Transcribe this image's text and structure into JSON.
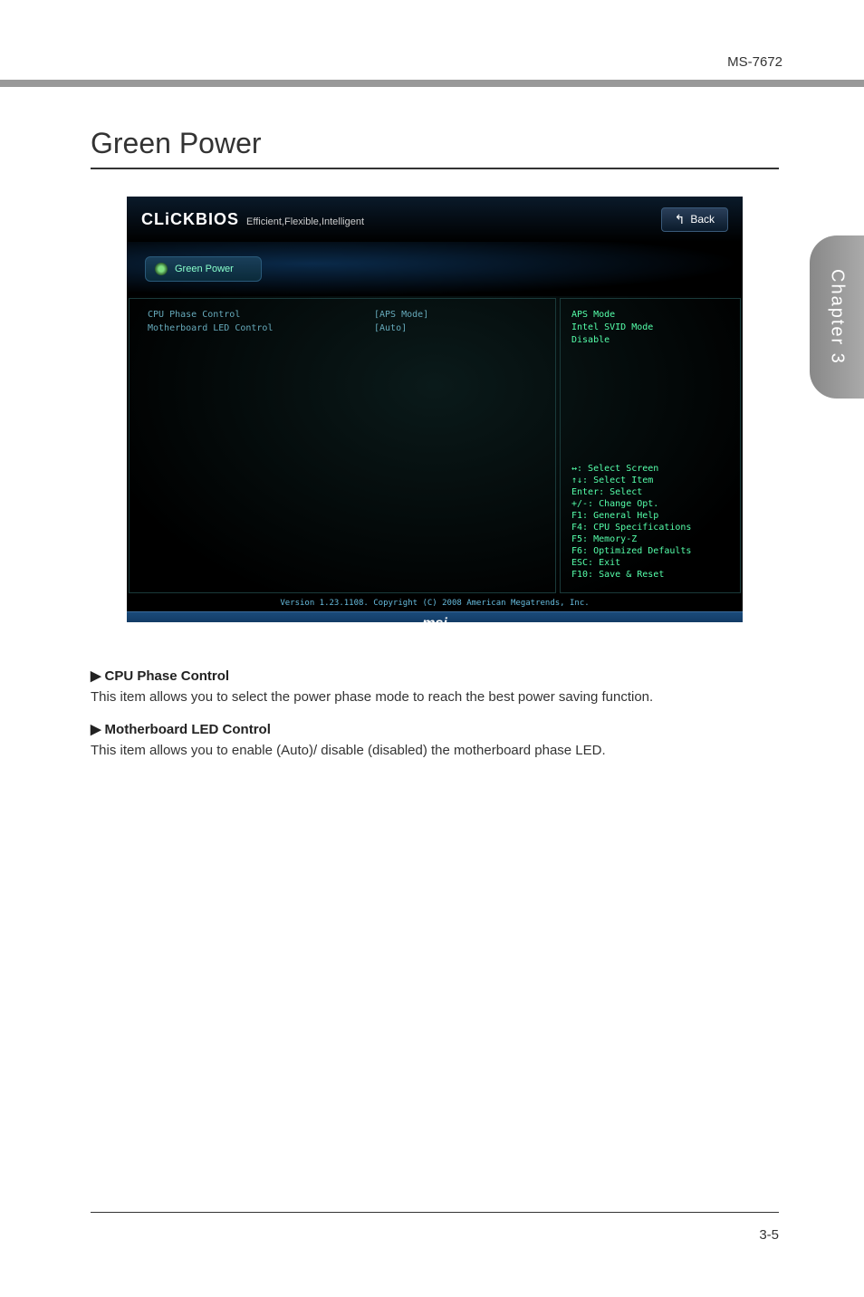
{
  "header": {
    "model": "MS-7672"
  },
  "sidetab": {
    "label": "Chapter 3"
  },
  "section": {
    "title": "Green Power"
  },
  "bios": {
    "logo_main": "CLiCKBIOS",
    "logo_sub": "Efficient,Flexible,Intelligent",
    "back_label": "Back",
    "tab_label": "Green Power",
    "settings": [
      {
        "label": "CPU Phase Control",
        "value": "[APS Mode]"
      },
      {
        "label": "Motherboard LED Control",
        "value": "[Auto]"
      }
    ],
    "options": [
      "APS Mode",
      "Intel SVID Mode",
      "Disable"
    ],
    "help": [
      "↔: Select Screen",
      "↑↓: Select Item",
      "Enter: Select",
      "+/-: Change Opt.",
      "F1: General Help",
      "F4: CPU Specifications",
      "F5: Memory-Z",
      "F6: Optimized Defaults",
      "ESC: Exit",
      "F10: Save & Reset"
    ],
    "footer_version": "Version 1.23.1108. Copyright (C) 2008 American Megatrends, Inc.",
    "brand": "msi"
  },
  "descriptions": [
    {
      "heading": "CPU Phase Control",
      "text": "This item allows you to select the power phase mode to reach the best power saving function."
    },
    {
      "heading": "Motherboard LED Control",
      "text": "This item allows you to enable (Auto)/ disable (disabled) the motherboard phase LED."
    }
  ],
  "footer": {
    "page": "3-5"
  },
  "glyphs": {
    "arrow": "▶",
    "back_arrow": "↰"
  }
}
